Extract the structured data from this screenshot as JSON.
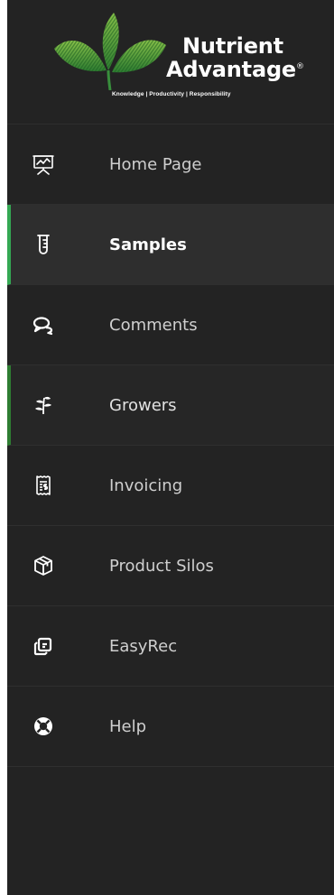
{
  "brand": {
    "name_line1": "Nutrient",
    "name_line2": "Advantage",
    "registered_mark": "®",
    "tagline": "Knowledge | Productivity | Responsibility"
  },
  "nav": {
    "items": [
      {
        "label": "Home Page",
        "icon": "presentation-chart-icon",
        "state": "default"
      },
      {
        "label": "Samples",
        "icon": "test-tube-icon",
        "state": "active"
      },
      {
        "label": "Comments",
        "icon": "chat-bubbles-icon",
        "state": "default"
      },
      {
        "label": "Growers",
        "icon": "plant-icon",
        "state": "hover"
      },
      {
        "label": "Invoicing",
        "icon": "receipt-icon",
        "state": "default"
      },
      {
        "label": "Product Silos",
        "icon": "box-icon",
        "state": "default"
      },
      {
        "label": "EasyRec",
        "icon": "clone-icon",
        "state": "default"
      },
      {
        "label": "Help",
        "icon": "life-ring-icon",
        "state": "default"
      }
    ]
  },
  "colors": {
    "sidebar_bg": "#232323",
    "active_bg": "#2e2e2e",
    "accent_green": "#34a853",
    "leaf_green": "#4caf50",
    "text": "#cfcfcf"
  }
}
